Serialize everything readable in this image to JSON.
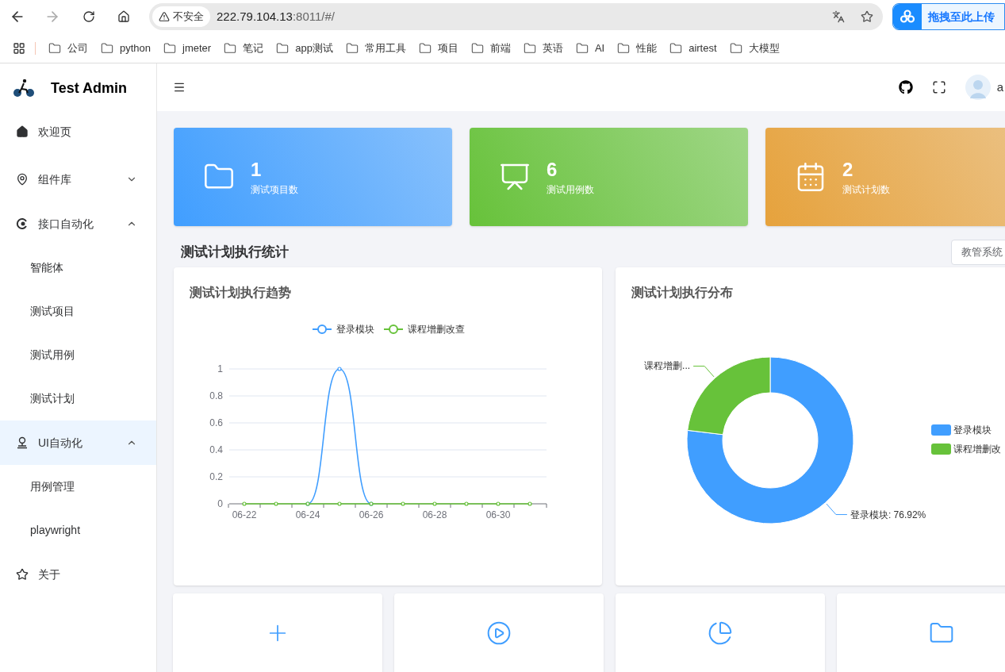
{
  "browser": {
    "security": "不安全",
    "url_host": "222.79.104.13",
    "url_rest": ":8011/#/",
    "extension": "拖拽至此上传",
    "bookmarks": [
      "公司",
      "python",
      "jmeter",
      "笔记",
      "app测试",
      "常用工具",
      "项目",
      "前端",
      "英语",
      "AI",
      "性能",
      "airtest",
      "大模型"
    ]
  },
  "sidebar": {
    "brand": "Test Admin",
    "items": [
      {
        "label": "欢迎页",
        "selected": false
      },
      {
        "label": "组件库",
        "selected": false,
        "expanded": false
      },
      {
        "label": "接口自动化",
        "selected": false,
        "expanded": true,
        "children": [
          {
            "label": "智能体",
            "selected": false
          },
          {
            "label": "测试项目",
            "selected": false
          },
          {
            "label": "测试用例",
            "selected": false
          },
          {
            "label": "测试计划",
            "selected": false
          }
        ]
      },
      {
        "label": "UI自动化",
        "selected": true,
        "expanded": true,
        "children": [
          {
            "label": "用例管理",
            "selected": false
          },
          {
            "label": "playwright",
            "selected": false
          }
        ]
      },
      {
        "label": "关于",
        "selected": false
      }
    ]
  },
  "header": {
    "user": "a"
  },
  "stats": [
    {
      "value": "1",
      "label": "测试项目数",
      "kind": "folder",
      "color": "#409eff"
    },
    {
      "value": "6",
      "label": "测试用例数",
      "kind": "presentation",
      "color": "#67c23a"
    },
    {
      "value": "2",
      "label": "测试计划数",
      "kind": "calendar",
      "color": "#e6a23c"
    }
  ],
  "section": {
    "title": "测试计划执行统计",
    "project_select": "教管系统"
  },
  "trend": {
    "title": "测试计划执行趋势",
    "chart_data": {
      "type": "line",
      "categories": [
        "06-22",
        null,
        "06-24",
        null,
        "06-26",
        null,
        "06-28",
        null,
        "06-30",
        null
      ],
      "series": [
        {
          "name": "登录模块",
          "color": "#409eff",
          "marker": "circle",
          "values": [
            null,
            null,
            0,
            1,
            0,
            null,
            null,
            null,
            null,
            null
          ]
        },
        {
          "name": "课程增删改查",
          "color": "#67c23a",
          "marker": "circle",
          "values": [
            0,
            0,
            0,
            0,
            0,
            0,
            0,
            0,
            0,
            0
          ]
        }
      ],
      "ylim": [
        0,
        1
      ],
      "yticks": [
        0,
        0.2,
        0.4,
        0.6,
        0.8,
        1
      ],
      "grid": true,
      "legend": "top"
    }
  },
  "distribution": {
    "title": "测试计划执行分布",
    "chart_data": {
      "type": "donut",
      "categories": [
        "登录模块",
        "课程增删改"
      ],
      "values": [
        76.92,
        23.08
      ],
      "colors": [
        "#409eff",
        "#67c23a"
      ],
      "annotations": [
        {
          "text": "登录模块: 76.92%"
        },
        {
          "text": "课程增删..."
        }
      ],
      "legend": "right"
    }
  },
  "quick_actions": [
    {
      "kind": "add"
    },
    {
      "kind": "run"
    },
    {
      "kind": "report"
    },
    {
      "kind": "folder"
    }
  ]
}
